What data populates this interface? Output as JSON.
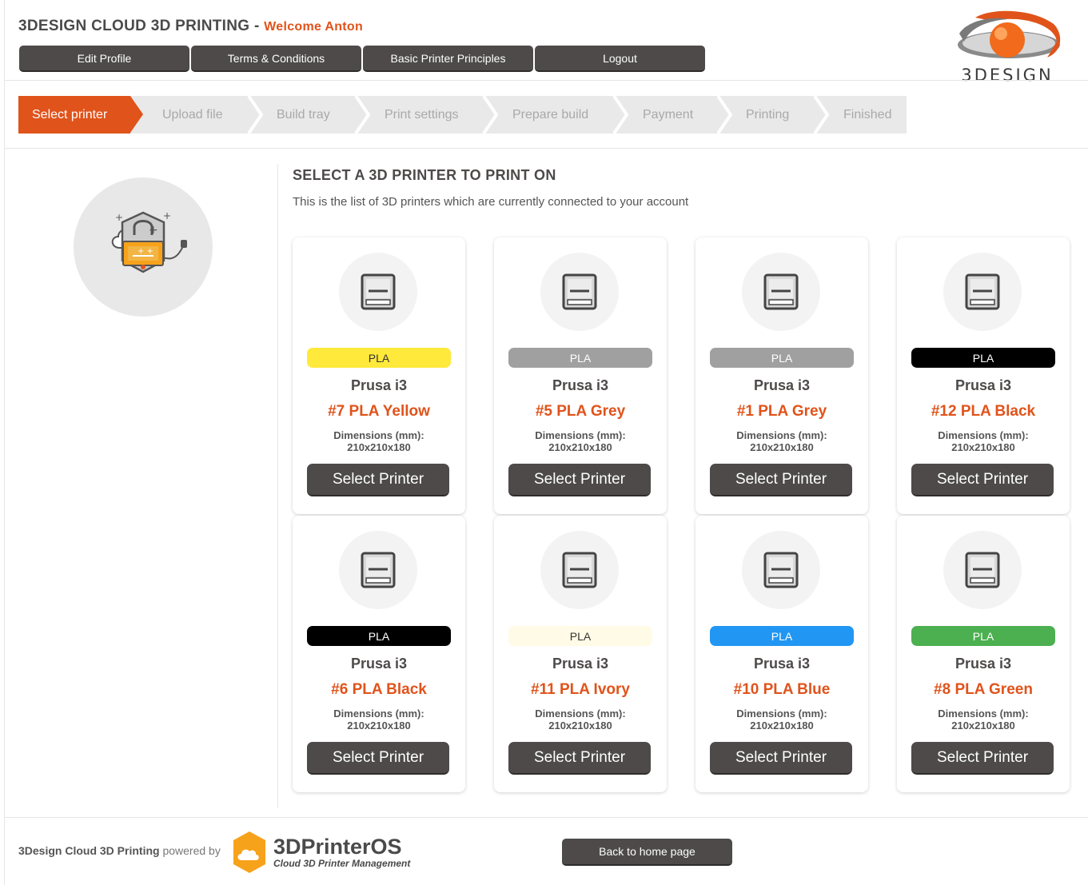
{
  "header": {
    "app_title": "3DESIGN CLOUD 3D PRINTING",
    "title_dash": " - ",
    "welcome": "Welcome Anton",
    "nav": [
      "Edit Profile",
      "Terms & Conditions",
      "Basic Printer Principles",
      "Logout"
    ],
    "logo_text": "3DESIGN"
  },
  "steps": [
    "Select printer",
    "Upload file",
    "Build tray",
    "Print settings",
    "Prepare build",
    "Payment",
    "Printing",
    "Finished"
  ],
  "active_step": "Select printer",
  "main": {
    "title": "SELECT A 3D PRINTER TO PRINT ON",
    "subtitle": "This is the list of 3D printers which are currently connected to your account"
  },
  "printers": [
    {
      "material": "PLA",
      "color": "#ffe93b",
      "text_color": "#333333",
      "model": "Prusa i3",
      "name": "#7 PLA Yellow",
      "dim_label": "Dimensions (mm):",
      "dims": "210x210x180",
      "button": "Select Printer"
    },
    {
      "material": "PLA",
      "color": "#a0a0a0",
      "text_color": "#ffffff",
      "model": "Prusa i3",
      "name": "#5 PLA Grey",
      "dim_label": "Dimensions (mm):",
      "dims": "210x210x180",
      "button": "Select Printer"
    },
    {
      "material": "PLA",
      "color": "#a0a0a0",
      "text_color": "#ffffff",
      "model": "Prusa i3",
      "name": "#1 PLA Grey",
      "dim_label": "Dimensions (mm):",
      "dims": "210x210x180",
      "button": "Select Printer"
    },
    {
      "material": "PLA",
      "color": "#000000",
      "text_color": "#ffffff",
      "model": "Prusa i3",
      "name": "#12 PLA Black",
      "dim_label": "Dimensions (mm):",
      "dims": "210x210x180",
      "button": "Select Printer"
    },
    {
      "material": "PLA",
      "color": "#000000",
      "text_color": "#ffffff",
      "model": "Prusa i3",
      "name": "#6 PLA Black",
      "dim_label": "Dimensions (mm):",
      "dims": "210x210x180",
      "button": "Select Printer"
    },
    {
      "material": "PLA",
      "color": "#fffbe6",
      "text_color": "#333333",
      "model": "Prusa i3",
      "name": "#11 PLA Ivory",
      "dim_label": "Dimensions (mm):",
      "dims": "210x210x180",
      "button": "Select Printer"
    },
    {
      "material": "PLA",
      "color": "#2196f3",
      "text_color": "#ffffff",
      "model": "Prusa i3",
      "name": "#10 PLA Blue",
      "dim_label": "Dimensions (mm):",
      "dims": "210x210x180",
      "button": "Select Printer"
    },
    {
      "material": "PLA",
      "color": "#4caf50",
      "text_color": "#ffffff",
      "model": "Prusa i3",
      "name": "#8 PLA Green",
      "dim_label": "Dimensions (mm):",
      "dims": "210x210x180",
      "button": "Select Printer"
    }
  ],
  "footer": {
    "brand": "3Design Cloud 3D Printing",
    "powered_by": " powered by",
    "os_name": "3DPrinterOS",
    "os_tagline": "Cloud 3D Printer Management",
    "home_button": "Back to home page"
  },
  "colors": {
    "accent": "#e0531b",
    "button": "#4d4a49"
  }
}
